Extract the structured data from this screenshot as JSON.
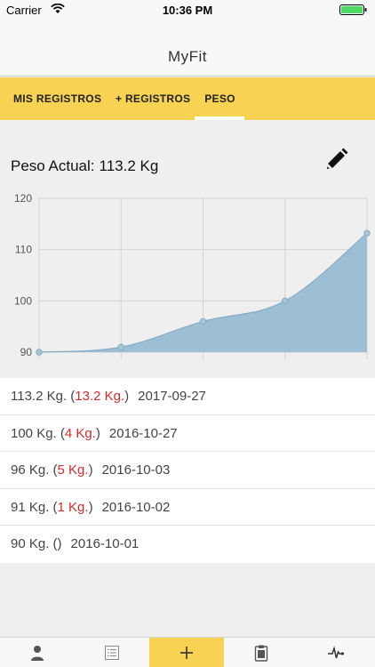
{
  "status_bar": {
    "carrier": "Carrier",
    "time": "10:36 PM"
  },
  "nav": {
    "title": "MyFit"
  },
  "tabs": [
    {
      "label": "MIS REGISTROS",
      "active": false
    },
    {
      "label": "+ REGISTROS",
      "active": false
    },
    {
      "label": "PESO",
      "active": true
    }
  ],
  "weight": {
    "label": "Peso Actual:",
    "value": "113.2 Kg"
  },
  "chart_data": {
    "type": "area",
    "x": [
      "2016-10-01",
      "2016-10-02",
      "2016-10-03",
      "2016-10-27",
      "2017-09-27"
    ],
    "series": [
      {
        "values": [
          90,
          91,
          96,
          100,
          113.2
        ]
      }
    ],
    "yticks": [
      "90",
      "100",
      "110",
      "120"
    ],
    "ylim": [
      90,
      120
    ],
    "grid": true,
    "color": "#9dbfd3"
  },
  "history": [
    {
      "weight": "113.2 Kg.",
      "diff": "13.2 Kg.",
      "date": "2017-09-27"
    },
    {
      "weight": "100 Kg.",
      "diff": "4 Kg.",
      "date": "2016-10-27"
    },
    {
      "weight": "96 Kg.",
      "diff": "5 Kg.",
      "date": "2016-10-03"
    },
    {
      "weight": "91 Kg.",
      "diff": "1 Kg.",
      "date": "2016-10-02"
    },
    {
      "weight": "90 Kg.",
      "diff": "",
      "date": "2016-10-01"
    }
  ],
  "bottom_tabs": [
    {
      "icon": "person-icon",
      "active": false
    },
    {
      "icon": "list-icon",
      "active": false
    },
    {
      "icon": "plus-icon",
      "active": true
    },
    {
      "icon": "clipboard-icon",
      "active": false
    },
    {
      "icon": "heartbeat-icon",
      "active": false
    }
  ],
  "colors": {
    "accent": "#f7d253",
    "diff": "#d62b2b",
    "chart_fill": "#9dbfd3"
  }
}
